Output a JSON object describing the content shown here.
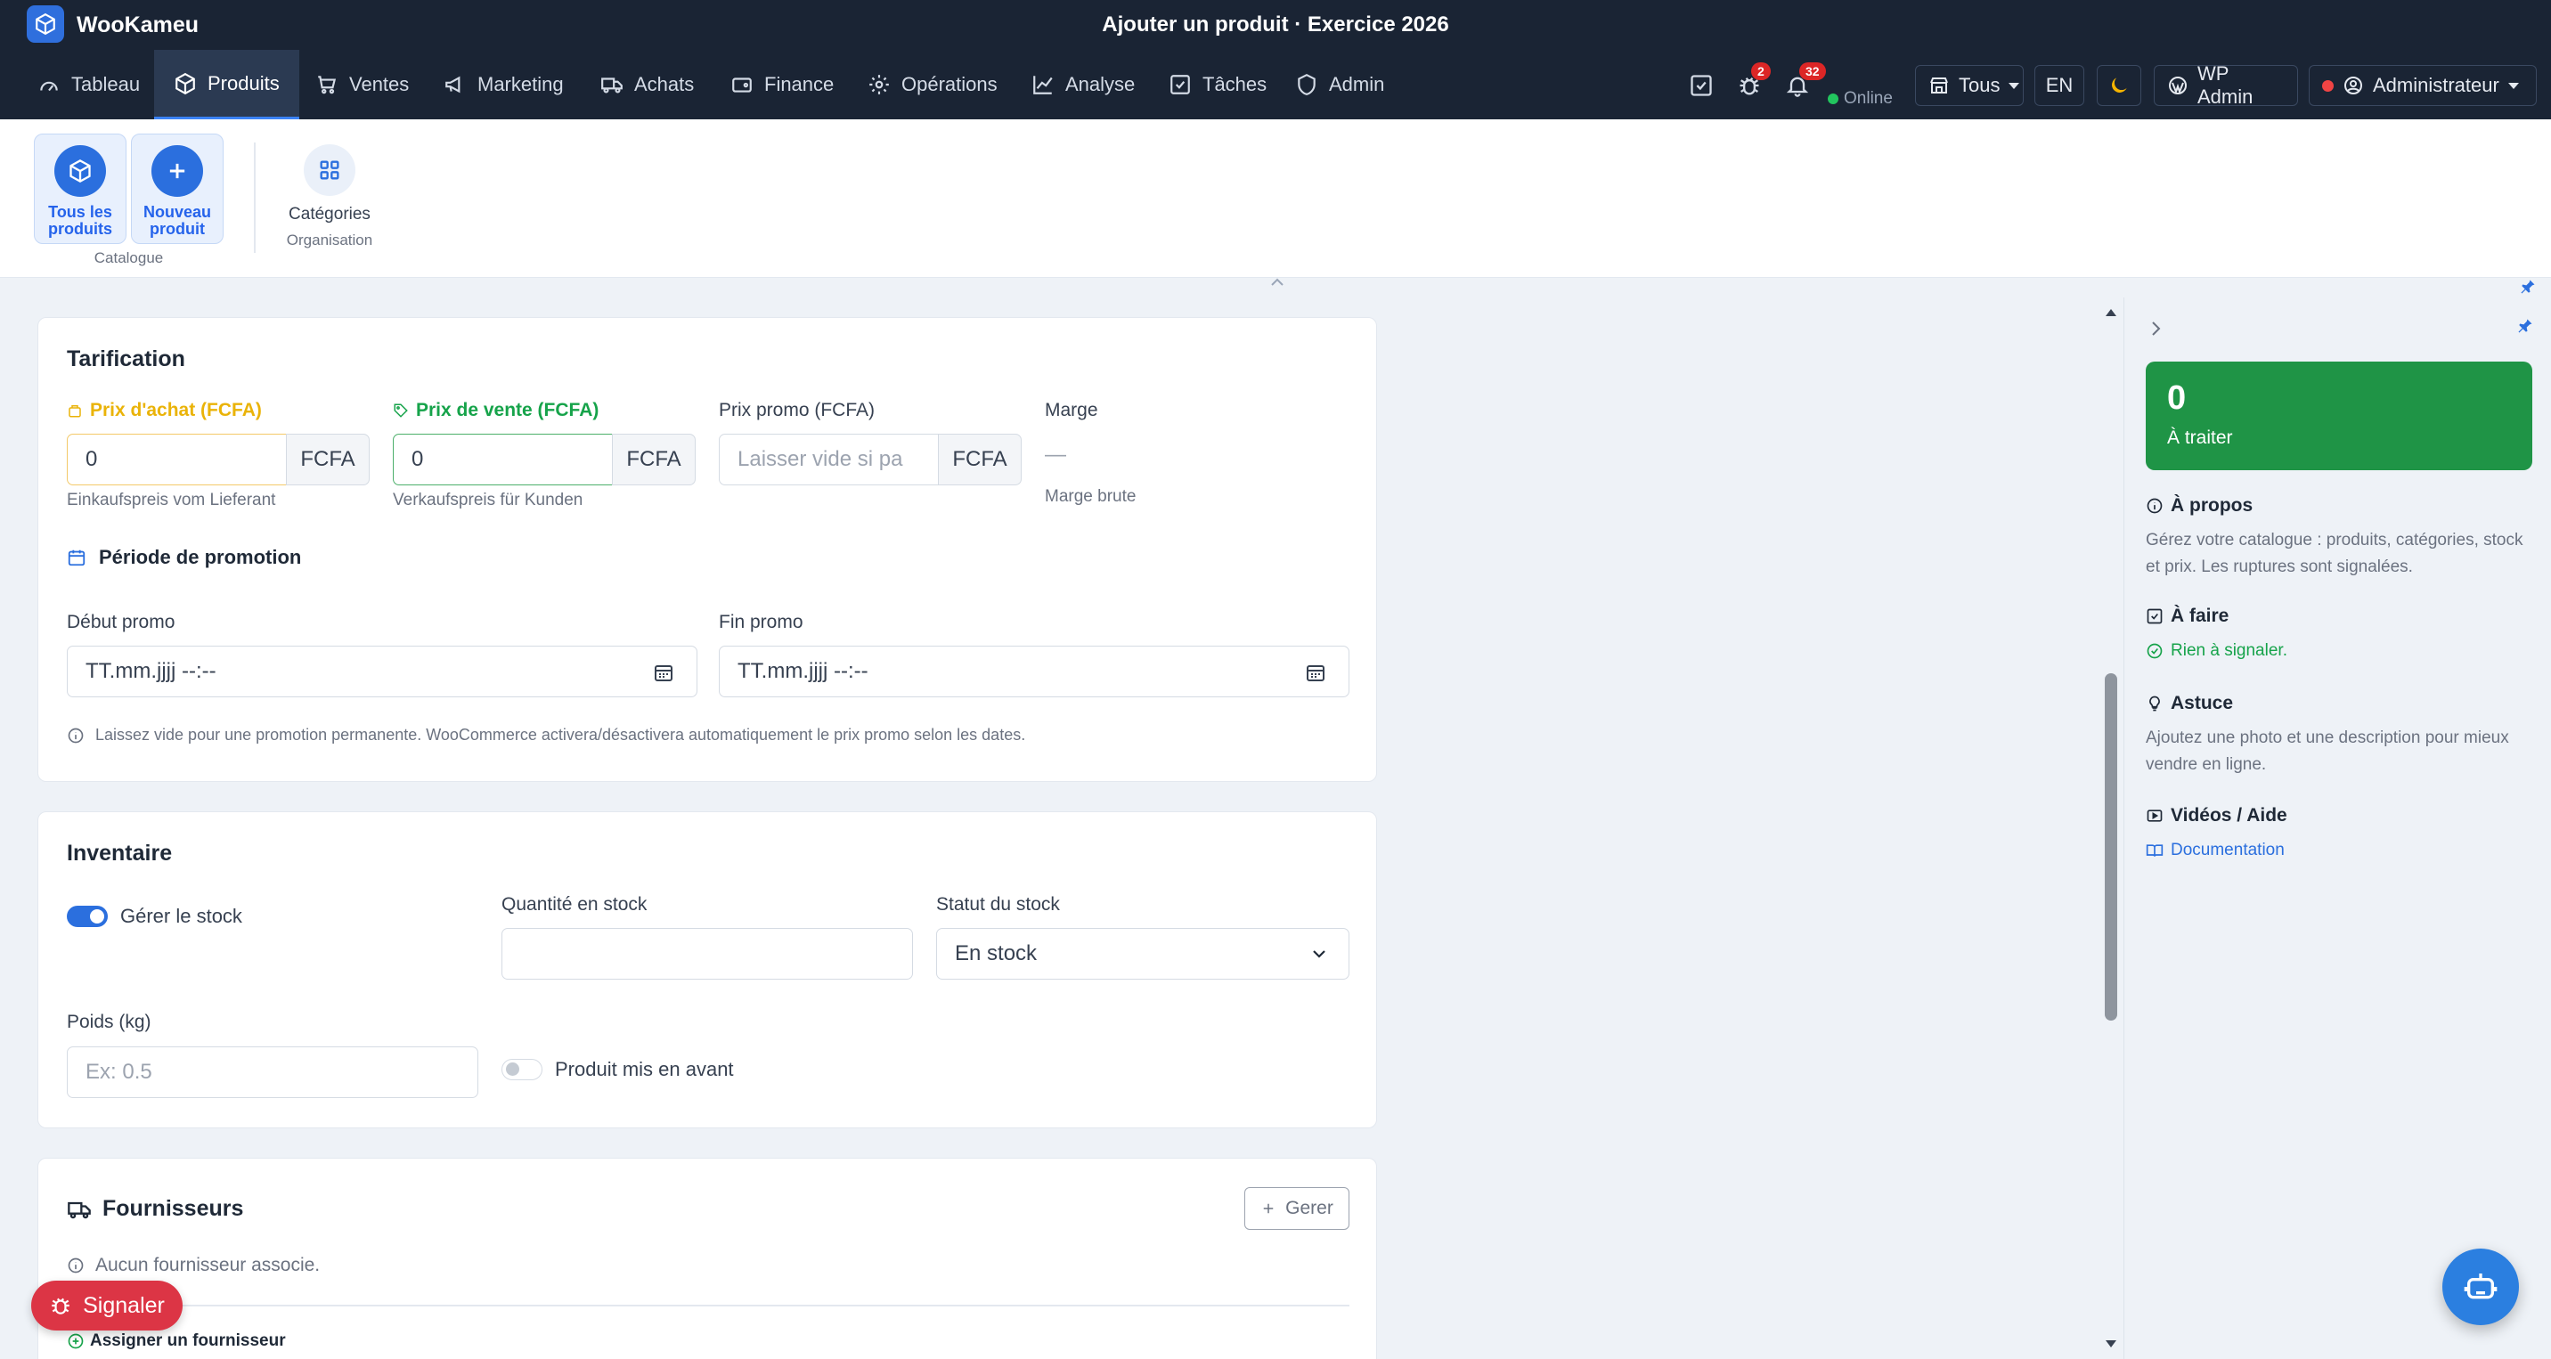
{
  "window": {
    "app_name": "WooKameu",
    "title": "Ajouter un produit · Exercice 2026"
  },
  "nav": {
    "items": [
      {
        "label": "Tableau",
        "icon": "gauge-icon"
      },
      {
        "label": "Produits",
        "icon": "box-icon",
        "active": true
      },
      {
        "label": "Ventes",
        "icon": "cart-icon"
      },
      {
        "label": "Marketing",
        "icon": "megaphone-icon"
      },
      {
        "label": "Achats",
        "icon": "truck-icon"
      },
      {
        "label": "Finance",
        "icon": "wallet-icon"
      },
      {
        "label": "Opérations",
        "icon": "gear-icon"
      },
      {
        "label": "Analyse",
        "icon": "chart-line-icon"
      },
      {
        "label": "Tâches",
        "icon": "check-square-icon"
      },
      {
        "label": "Admin",
        "icon": "shield-icon"
      }
    ],
    "bug_badge": "2",
    "bell_badge": "32",
    "online_label": "Online",
    "store_select": "Tous",
    "lang_button": "EN",
    "wp_admin": "WP Admin",
    "user": "Administrateur"
  },
  "ribbon": {
    "all_products": "Tous les produits",
    "new_product": "Nouveau produit",
    "catalogue_group": "Catalogue",
    "categories": "Catégories",
    "organisation_group": "Organisation"
  },
  "pricing": {
    "title": "Tarification",
    "purchase_label": "Prix d'achat (FCFA)",
    "purchase_value": "0",
    "purchase_addon": "FCFA",
    "purchase_hint": "Einkaufspreis vom Lieferant",
    "sale_label": "Prix de vente (FCFA)",
    "sale_value": "0",
    "sale_addon": "FCFA",
    "sale_hint": "Verkaufspreis für Kunden",
    "promo_label": "Prix promo (FCFA)",
    "promo_placeholder": "Laisser vide si pa",
    "promo_addon": "FCFA",
    "margin_label": "Marge",
    "margin_value": "—",
    "margin_hint": "Marge brute",
    "promo_period": "Période de promotion",
    "start_label": "Début promo",
    "start_placeholder": "TT.mm.jjjj --:--",
    "end_label": "Fin promo",
    "end_placeholder": "TT.mm.jjjj --:--",
    "note": "Laissez vide pour une promotion permanente. WooCommerce activera/désactivera automatiquement le prix promo selon les dates."
  },
  "inventory": {
    "title": "Inventaire",
    "manage_stock": "Gérer le stock",
    "manage_stock_on": true,
    "qty_label": "Quantité en stock",
    "qty_value": "",
    "status_label": "Statut du stock",
    "status_value": "En stock",
    "weight_label": "Poids (kg)",
    "weight_placeholder": "Ex: 0.5",
    "featured": "Produit mis en avant",
    "featured_on": false
  },
  "suppliers": {
    "title": "Fournisseurs",
    "manage_button": "Gerer",
    "empty": "Aucun fournisseur associe.",
    "assign": "Assigner un fournisseur"
  },
  "signal_button": "Signaler",
  "side": {
    "count": "0",
    "count_label": "À traiter",
    "about_title": "À propos",
    "about_text": "Gérez votre catalogue : produits, catégories, stock et prix. Les ruptures sont signalées.",
    "todo_title": "À faire",
    "todo_text": "Rien à signaler.",
    "tip_title": "Astuce",
    "tip_text": "Ajoutez une photo et une description pour mieux vendre en ligne.",
    "videos_title": "Vidéos / Aide",
    "doc_link": "Documentation"
  },
  "colors": {
    "brand": "#2b6fde",
    "nav_bg": "#1a2434",
    "success": "#16a34a",
    "danger": "#dc2626",
    "warning": "#eab308"
  }
}
